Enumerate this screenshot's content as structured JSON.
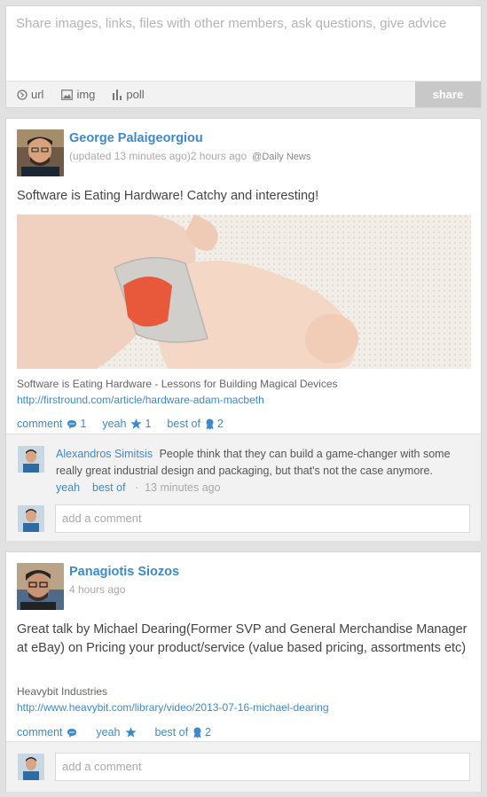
{
  "composer": {
    "placeholder": "Share images, links, files with other members, ask questions, give advice",
    "url_label": "url",
    "img_label": "img",
    "poll_label": "poll",
    "share_label": "share"
  },
  "posts": [
    {
      "author": "George Palaigeorgiou",
      "updated": "(updated 13 minutes ago)",
      "time": "2 hours ago",
      "source": "@Daily News",
      "text": "Software is Eating Hardware! Catchy and interesting!",
      "link_title": "Software is Eating Hardware - Lessons for Building Magical Devices",
      "link_url": "http://firstround.com/article/hardware-adam-macbeth",
      "comment_label": "comment",
      "comment_count": "1",
      "yeah_label": "yeah",
      "yeah_count": "1",
      "bestof_label": "best of",
      "bestof_count": "2",
      "comments": [
        {
          "author": "Alexandros Simitsis",
          "text": "People think that they can build a game-changer with some really great industrial design and packaging, but that's not the case anymore.",
          "yeah_label": "yeah",
          "bestof_label": "best of",
          "separator": "·",
          "time": "13 minutes ago"
        }
      ],
      "add_comment_placeholder": "add a comment"
    },
    {
      "author": "Panagiotis Siozos",
      "time": "4 hours ago",
      "text": "Great talk by Michael Dearing(Former SVP and General Merchandise Manager at eBay) on Pricing your product/service (value based pricing, assortments etc)",
      "link_title": "Heavybit Industries",
      "link_url": "http://www.heavybit.com/library/video/2013-07-16-michael-dearing",
      "comment_label": "comment",
      "yeah_label": "yeah",
      "bestof_label": "best of",
      "bestof_count": "2",
      "add_comment_placeholder": "add a comment"
    }
  ],
  "colors": {
    "link_blue": "#3b8bcc",
    "page_bg": "#e1e1e1",
    "share_button": "#c8c8c8",
    "comment_zone_bg": "#f2f2f2"
  }
}
